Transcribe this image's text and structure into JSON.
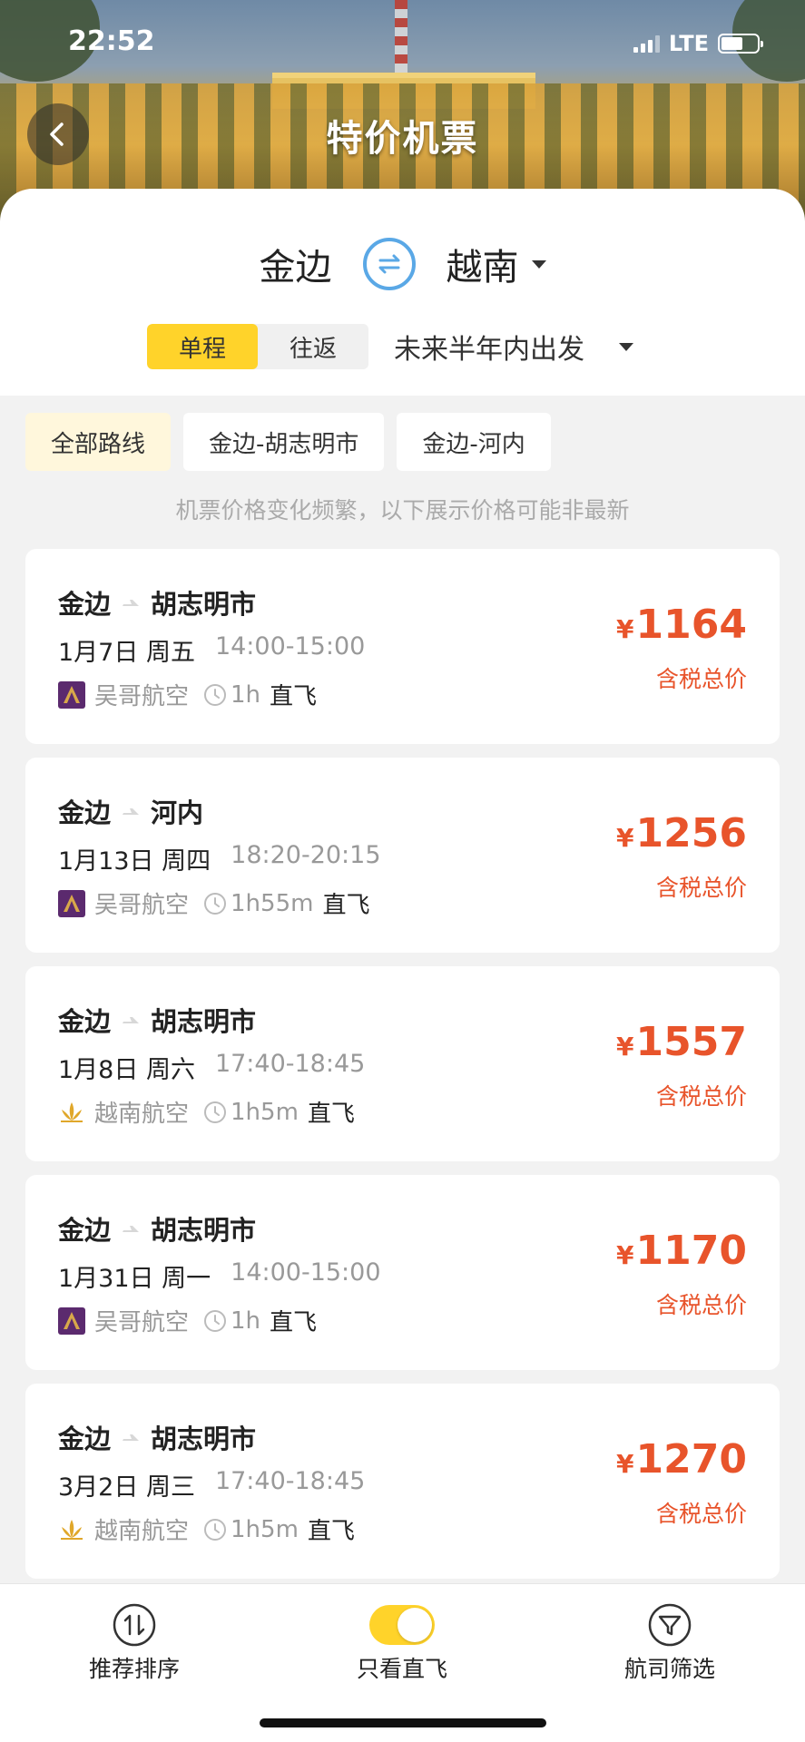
{
  "status": {
    "time": "22:52",
    "network": "LTE"
  },
  "header": {
    "title": "特价机票"
  },
  "route": {
    "origin": "金边",
    "destination": "越南"
  },
  "trip_type": {
    "options": [
      "单程",
      "往返"
    ],
    "selected": "单程"
  },
  "date_filter": "未来半年内出发",
  "route_chips": [
    "全部路线",
    "金边-胡志明市",
    "金边-河内"
  ],
  "notice": "机票价格变化频繁，以下展示价格可能非最新",
  "flights": [
    {
      "from": "金边",
      "to": "胡志明市",
      "date": "1月7日",
      "weekday": "周五",
      "time": "14:00-15:00",
      "airline": "吴哥航空",
      "airline_logo": "angkor-air",
      "duration": "1h",
      "direct": "直飞",
      "currency": "¥",
      "price": "1164",
      "price_note": "含税总价"
    },
    {
      "from": "金边",
      "to": "河内",
      "date": "1月13日",
      "weekday": "周四",
      "time": "18:20-20:15",
      "airline": "吴哥航空",
      "airline_logo": "angkor-air",
      "duration": "1h55m",
      "direct": "直飞",
      "currency": "¥",
      "price": "1256",
      "price_note": "含税总价"
    },
    {
      "from": "金边",
      "to": "胡志明市",
      "date": "1月8日",
      "weekday": "周六",
      "time": "17:40-18:45",
      "airline": "越南航空",
      "airline_logo": "vietnam-airlines",
      "duration": "1h5m",
      "direct": "直飞",
      "currency": "¥",
      "price": "1557",
      "price_note": "含税总价"
    },
    {
      "from": "金边",
      "to": "胡志明市",
      "date": "1月31日",
      "weekday": "周一",
      "time": "14:00-15:00",
      "airline": "吴哥航空",
      "airline_logo": "angkor-air",
      "duration": "1h",
      "direct": "直飞",
      "currency": "¥",
      "price": "1170",
      "price_note": "含税总价"
    },
    {
      "from": "金边",
      "to": "胡志明市",
      "date": "3月2日",
      "weekday": "周三",
      "time": "17:40-18:45",
      "airline": "越南航空",
      "airline_logo": "vietnam-airlines",
      "duration": "1h5m",
      "direct": "直飞",
      "currency": "¥",
      "price": "1270",
      "price_note": "含税总价"
    }
  ],
  "tabbar": {
    "sort": "推荐排序",
    "direct_only": "只看直飞",
    "direct_only_on": true,
    "airline_filter": "航司筛选"
  },
  "colors": {
    "accent": "#ffd32a",
    "price": "#e8542b",
    "swap": "#5aa8e6"
  }
}
